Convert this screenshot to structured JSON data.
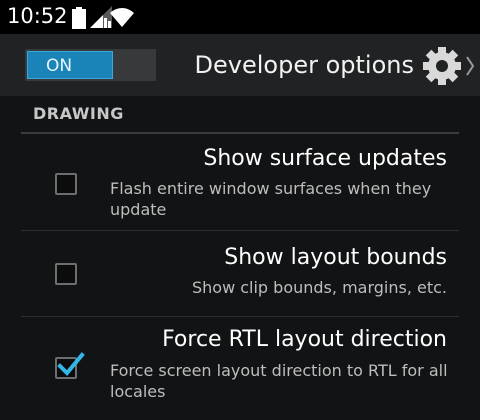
{
  "status_bar": {
    "time": "10:52",
    "icons": [
      "battery-icon",
      "signal-icon",
      "wifi-icon"
    ]
  },
  "action_bar": {
    "toggle_label": "ON",
    "toggle_on": true,
    "title": "Developer options",
    "icons": [
      "settings-gear-icon",
      "caret-right-icon"
    ]
  },
  "section": {
    "header": "DRAWING"
  },
  "preferences": [
    {
      "title": "Show surface updates",
      "summary": "Flash entire window surfaces when they update",
      "checked": false
    },
    {
      "title": "Show layout bounds",
      "summary": "Show clip bounds, margins, etc.",
      "checked": false
    },
    {
      "title": "Force RTL layout direction",
      "summary": "Force screen layout direction to RTL for all locales",
      "checked": true
    }
  ],
  "colors": {
    "accent": "#1a84b8",
    "check": "#33b5e5",
    "action_bar": "#212223",
    "background": "#121314"
  }
}
